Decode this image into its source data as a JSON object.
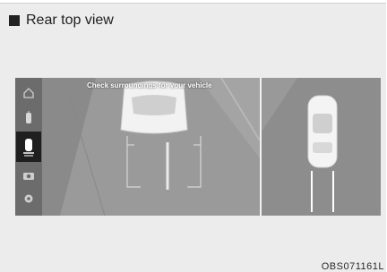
{
  "header": {
    "title": "Rear top view"
  },
  "screen": {
    "warning_text": "Check surroundings for your vehicle",
    "sidebar_icons": [
      "home-icon",
      "parking-sensor-icon",
      "rear-top-view-icon",
      "camera-icon",
      "settings-icon"
    ],
    "active_index": 2
  },
  "figure_code": "OBS071161L"
}
